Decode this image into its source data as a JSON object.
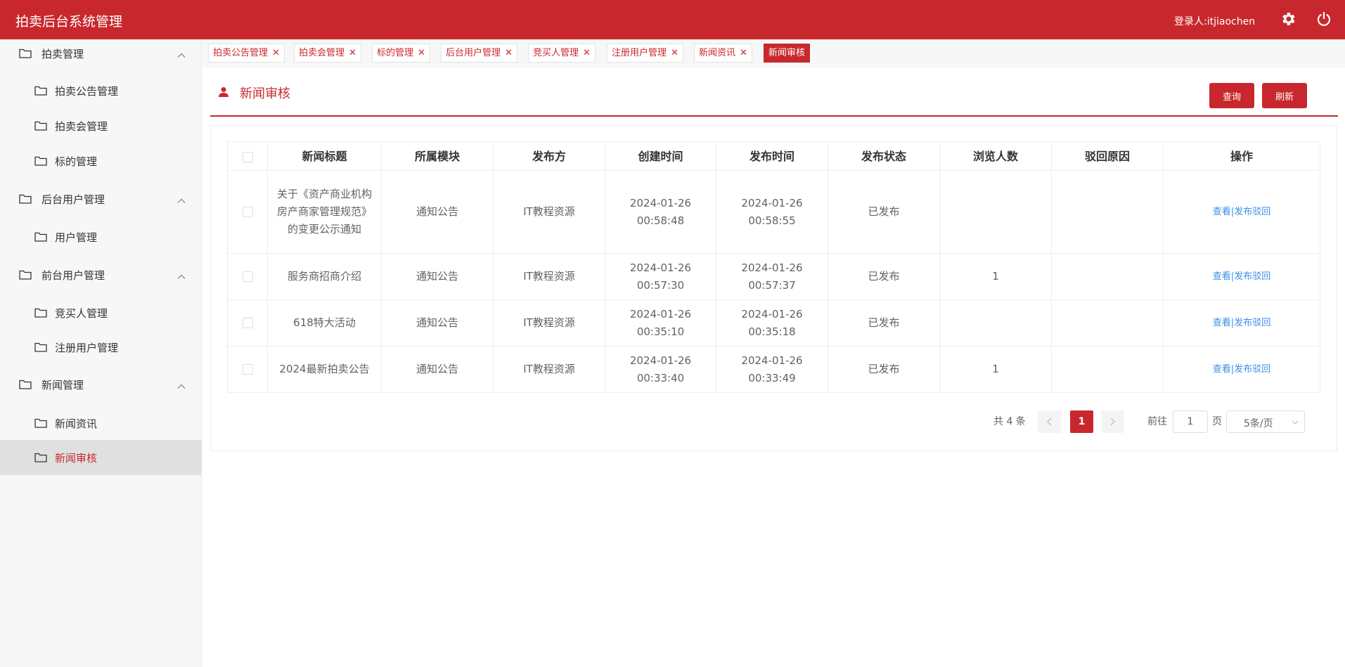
{
  "header": {
    "app_title": "拍卖后台系统管理",
    "login_user": "登录人:itjiaochen",
    "settings_icon": "gear-icon",
    "logout_icon": "power-icon",
    "brand_color": "#c8282d"
  },
  "sidebar": {
    "items": [
      {
        "label": "拍卖管理",
        "level": "group",
        "expanded": true
      },
      {
        "label": "拍卖公告管理",
        "level": "sub"
      },
      {
        "label": "拍卖会管理",
        "level": "sub"
      },
      {
        "label": "标的管理",
        "level": "sub"
      },
      {
        "label": "后台用户管理",
        "level": "group",
        "expanded": true
      },
      {
        "label": "用户管理",
        "level": "sub"
      },
      {
        "label": "前台用户管理",
        "level": "group",
        "expanded": true
      },
      {
        "label": "竞买人管理",
        "level": "sub"
      },
      {
        "label": "注册用户管理",
        "level": "sub"
      },
      {
        "label": "新闻管理",
        "level": "group",
        "expanded": true
      },
      {
        "label": "新闻资讯",
        "level": "sub"
      },
      {
        "label": "新闻审核",
        "level": "sub",
        "active": true
      }
    ]
  },
  "tabs": [
    {
      "label": "拍卖公告管理"
    },
    {
      "label": "拍卖会管理"
    },
    {
      "label": "标的管理"
    },
    {
      "label": "后台用户管理"
    },
    {
      "label": "竞买人管理"
    },
    {
      "label": "注册用户管理"
    },
    {
      "label": "新闻资讯"
    },
    {
      "label": "新闻审核",
      "active": true
    }
  ],
  "panel": {
    "title": "新闻审核",
    "query_label": "查询",
    "refresh_label": "刷新"
  },
  "table": {
    "columns": [
      "新闻标题",
      "所属模块",
      "发布方",
      "创建时间",
      "发布时间",
      "发布状态",
      "浏览人数",
      "驳回原因",
      "操作"
    ],
    "rows": [
      {
        "title": "关于《资产商业机构房产商家管理规范》的变更公示通知",
        "module": "通知公告",
        "publisher": "IT教程资源",
        "created": "2024-01-26 00:58:48",
        "published": "2024-01-26 00:58:55",
        "status": "已发布",
        "views": "",
        "reject_reason": "",
        "ops": {
          "view": "查看",
          "sep": "|",
          "reject": "发布驳回"
        }
      },
      {
        "title": "服务商招商介绍",
        "module": "通知公告",
        "publisher": "IT教程资源",
        "created": "2024-01-26 00:57:30",
        "published": "2024-01-26 00:57:37",
        "status": "已发布",
        "views": "1",
        "reject_reason": "",
        "ops": {
          "view": "查看",
          "sep": "|",
          "reject": "发布驳回"
        }
      },
      {
        "title": "618特大活动",
        "module": "通知公告",
        "publisher": "IT教程资源",
        "created": "2024-01-26 00:35:10",
        "published": "2024-01-26 00:35:18",
        "status": "已发布",
        "views": "",
        "reject_reason": "",
        "ops": {
          "view": "查看",
          "sep": "|",
          "reject": "发布驳回"
        }
      },
      {
        "title": "2024最新拍卖公告",
        "module": "通知公告",
        "publisher": "IT教程资源",
        "created": "2024-01-26 00:33:40",
        "published": "2024-01-26 00:33:49",
        "status": "已发布",
        "views": "1",
        "reject_reason": "",
        "ops": {
          "view": "查看",
          "sep": "|",
          "reject": "发布驳回"
        }
      }
    ]
  },
  "pagination": {
    "total_text": "共 4 条",
    "current_page": "1",
    "goto_label": "前往",
    "goto_value": "1",
    "page_suffix": "页",
    "page_size": "5条/页"
  }
}
